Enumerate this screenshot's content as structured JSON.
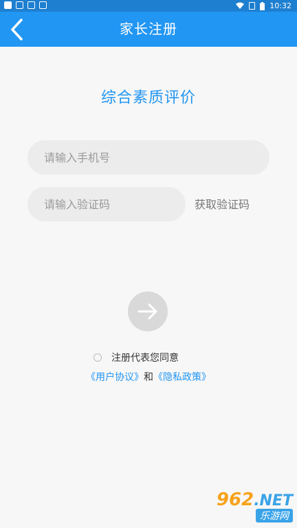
{
  "status_bar": {
    "time": "10:32",
    "icons": [
      "notification-icon",
      "keyboard-icon",
      "app-icon",
      "font-icon",
      "wifi-icon",
      "sim-icon",
      "battery-icon"
    ]
  },
  "app_bar": {
    "title": "家长注册",
    "back_icon": "chevron-left-icon"
  },
  "heading": "综合素质评价",
  "form": {
    "phone_placeholder": "请输入手机号",
    "phone_value": "",
    "code_placeholder": "请输入验证码",
    "code_value": "",
    "get_code_label": "获取验证码"
  },
  "submit": {
    "icon": "arrow-right-icon"
  },
  "agreement": {
    "checked": false,
    "text": "注册代表您同意",
    "user_agreement": "《用户协议》",
    "and": "和",
    "privacy_policy": "《隐私政策》"
  },
  "watermark": {
    "number": "962",
    "net": ".NET",
    "site": "乐游网"
  },
  "colors": {
    "primary": "#2196f3",
    "status_bar": "#1e7fd0",
    "background": "#f7f7f7",
    "input_bg": "#ececec",
    "submit_bg": "#d9d9d9"
  }
}
